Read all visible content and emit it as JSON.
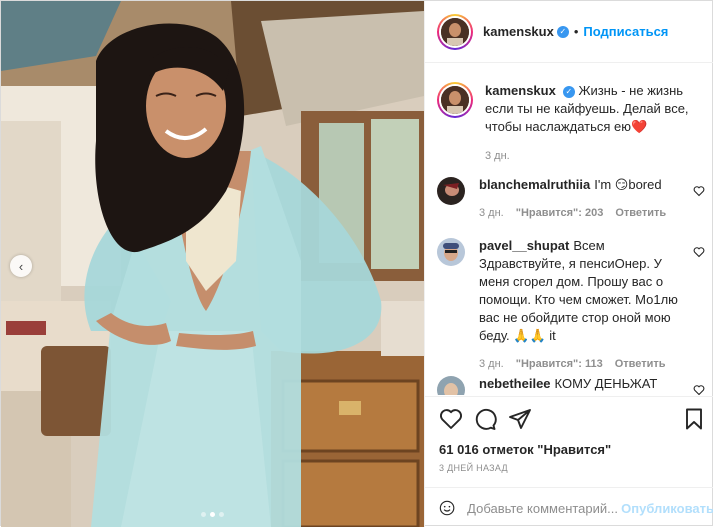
{
  "post": {
    "author": {
      "username": "kamenskux",
      "verified_icon": "verified-badge-icon",
      "separator": "•",
      "follow_label": "Подписаться"
    },
    "caption": {
      "username": "kamenskux",
      "text": "Жизнь - не жизнь если ты не кайфуешь. Делай все, чтобы наслаждаться ею",
      "emoji": "❤️",
      "time": "3 дн."
    },
    "comments": [
      {
        "username": "blanchemalruthiia",
        "text": "I'm 😏bored",
        "time": "3 дн.",
        "likes": "\"Нравится\": 203",
        "reply": "Ответить"
      },
      {
        "username": "pavel__shupat",
        "text": "Всем Здравствуйте, я пенсиОнер. У меня сгорел дом. Прошу вас о помощи. Кто чем сможет. Мо1лю вас не обойдите стор оной мою беду. 🙏🙏 it",
        "time": "3 дн.",
        "likes": "\"Нравится\": 113",
        "reply": "Ответить"
      },
      {
        "username": "nebetheilee",
        "text": "КОМУ ДЕНЬЖАТ",
        "time": "",
        "likes": "",
        "reply": ""
      }
    ],
    "likes_text": "61 016 отметок \"Нравится\"",
    "date_text": "3 дней назад",
    "comment_placeholder": "Добавьте комментарий...",
    "publish_label": "Опубликовать",
    "carousel": {
      "total": 3,
      "active": 1
    }
  },
  "colors": {
    "link_blue": "#0095f6",
    "publish_disabled": "#b2dffc",
    "muted": "#8e8e8e",
    "heart_red": "#ed4956"
  }
}
